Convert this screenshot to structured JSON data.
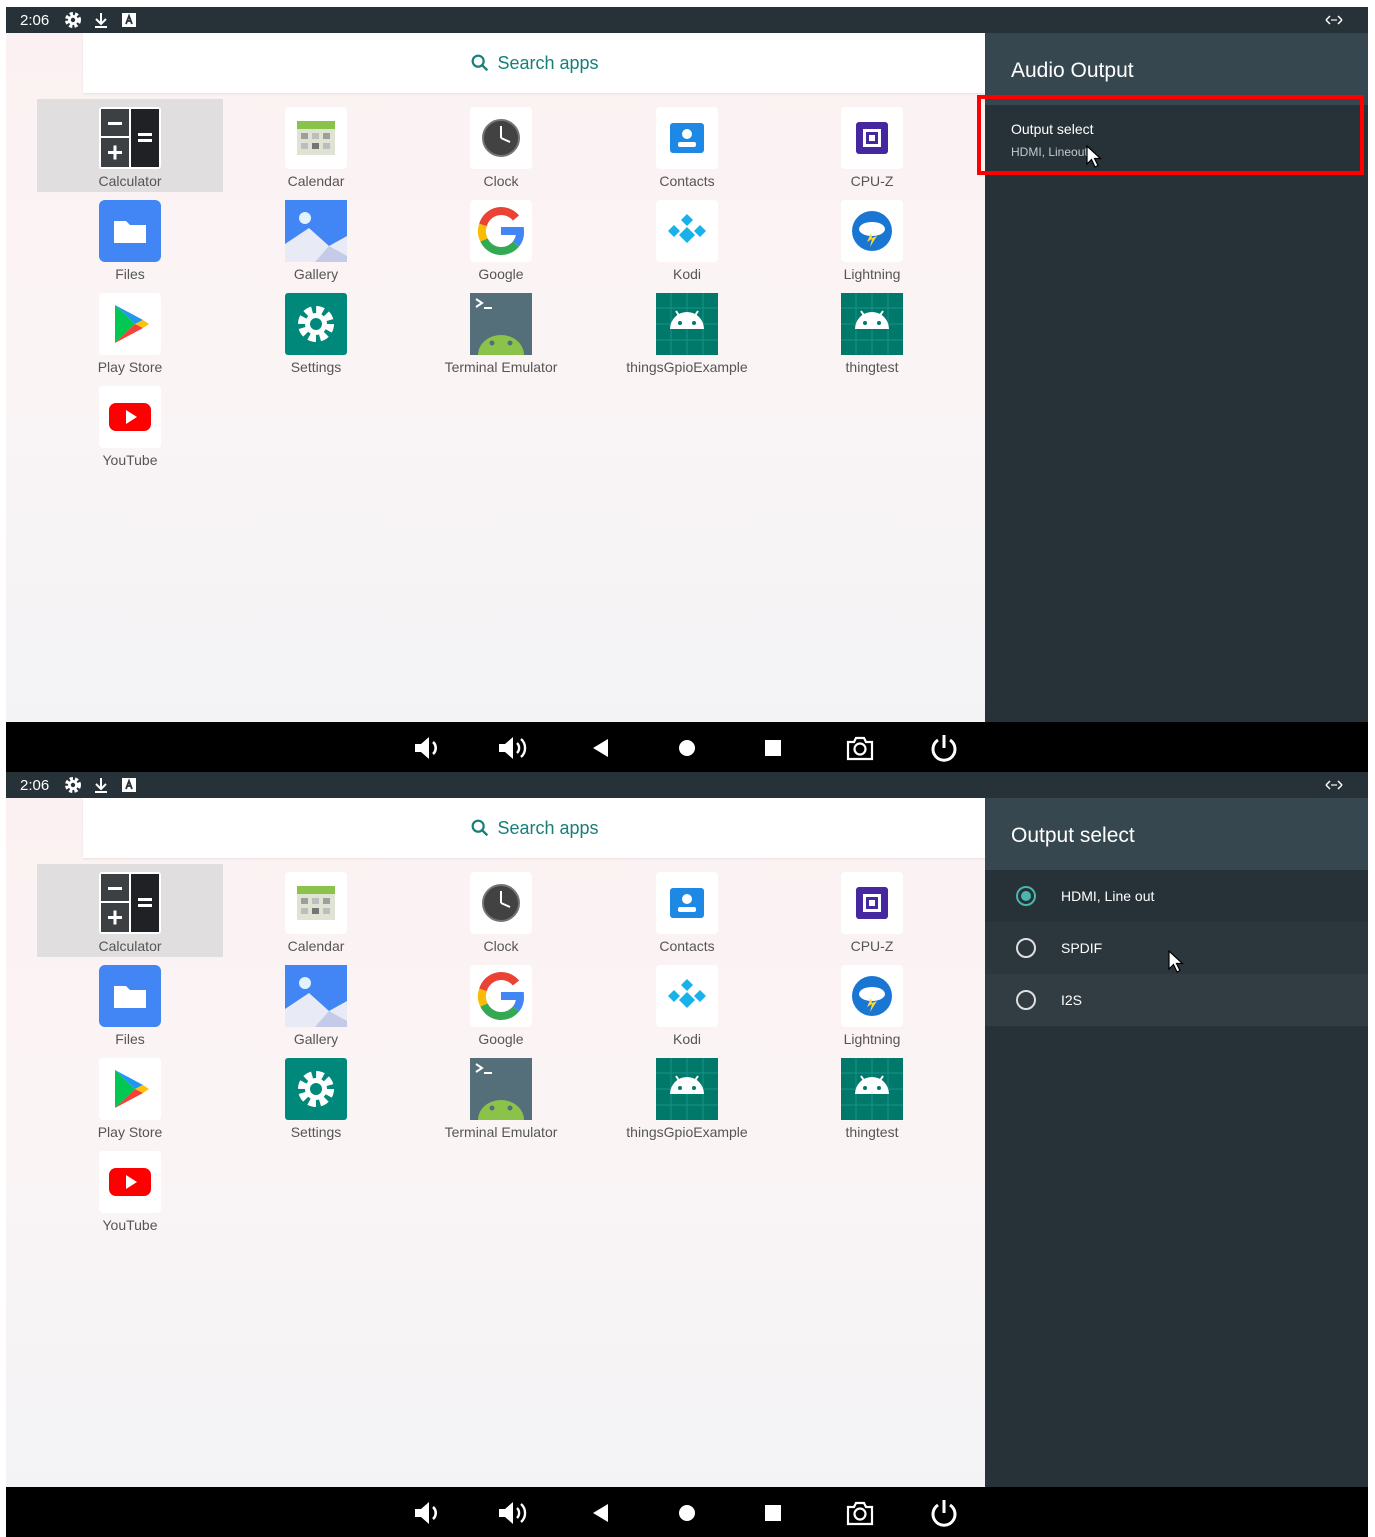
{
  "status_bar": {
    "time": "2:06",
    "icons": [
      "gear-icon",
      "download-icon",
      "notification-a-icon"
    ],
    "right_icon": "expand-arrows-icon"
  },
  "search": {
    "label": "Search apps"
  },
  "apps": [
    {
      "label": "Calculator",
      "icon": "calculator-icon",
      "selected": true
    },
    {
      "label": "Calendar",
      "icon": "calendar-icon"
    },
    {
      "label": "Clock",
      "icon": "clock-icon"
    },
    {
      "label": "Contacts",
      "icon": "contacts-icon"
    },
    {
      "label": "CPU-Z",
      "icon": "cpu-icon"
    },
    {
      "label": "Files",
      "icon": "folder-icon"
    },
    {
      "label": "Gallery",
      "icon": "gallery-icon"
    },
    {
      "label": "Google",
      "icon": "google-icon"
    },
    {
      "label": "Kodi",
      "icon": "kodi-icon"
    },
    {
      "label": "Lightning",
      "icon": "lightning-icon"
    },
    {
      "label": "Play Store",
      "icon": "play-store-icon"
    },
    {
      "label": "Settings",
      "icon": "settings-gear-icon"
    },
    {
      "label": "Terminal Emulator",
      "icon": "terminal-icon"
    },
    {
      "label": "thingsGpioExample",
      "icon": "android-icon"
    },
    {
      "label": "thingtest",
      "icon": "android-icon"
    },
    {
      "label": "YouTube",
      "icon": "youtube-icon"
    }
  ],
  "nav_bar": [
    "volume-down-icon",
    "volume-up-icon",
    "back-icon",
    "home-icon",
    "recents-icon",
    "camera-icon",
    "power-icon"
  ],
  "top_panel": {
    "title": "Audio Output",
    "item": {
      "title": "Output select",
      "summary": "HDMI, Lineout"
    }
  },
  "bottom_panel": {
    "title": "Output select",
    "options": [
      {
        "label": "HDMI, Line out",
        "checked": true
      },
      {
        "label": "SPDIF",
        "checked": false
      },
      {
        "label": "I2S",
        "checked": false
      }
    ]
  },
  "colors": {
    "status_bar": "#263238",
    "panel_bg": "#263238",
    "panel_header": "#37474f",
    "accent": "#4db6ac",
    "highlight": "#ff0000"
  }
}
